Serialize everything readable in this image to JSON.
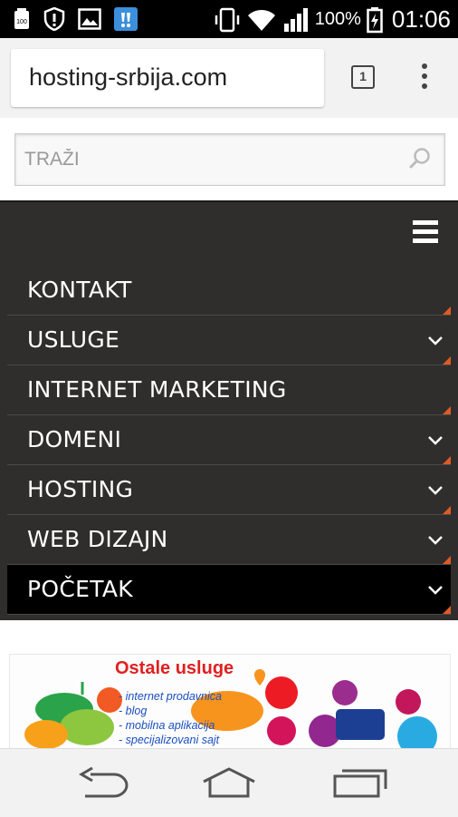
{
  "status_bar": {
    "battery_percent": "100%",
    "time": "01:06",
    "left_icons": [
      "storage-icon",
      "alert-shield-icon",
      "gallery-icon",
      "app-notification-icon"
    ],
    "right_icons": [
      "vibrate-icon",
      "wifi-icon",
      "signal-icon",
      "battery-icon"
    ]
  },
  "browser": {
    "url": "hosting-srbija.com",
    "tab_count": "1"
  },
  "search": {
    "placeholder": "TRAŽI"
  },
  "menu": {
    "items": [
      {
        "label": "KONTAKT",
        "has_submenu": false,
        "active": false
      },
      {
        "label": "USLUGE",
        "has_submenu": true,
        "active": false
      },
      {
        "label": "INTERNET MARKETING",
        "has_submenu": false,
        "active": false
      },
      {
        "label": "DOMENI",
        "has_submenu": true,
        "active": false
      },
      {
        "label": "HOSTING",
        "has_submenu": true,
        "active": false
      },
      {
        "label": "WEB DIZAJN",
        "has_submenu": true,
        "active": false
      },
      {
        "label": "POČETAK",
        "has_submenu": true,
        "active": true
      }
    ]
  },
  "banner": {
    "title": "Ostale usluge",
    "list": [
      "- internet prodavnica",
      "- blog",
      "- mobilna aplikacija",
      "- specijalizovani sajt"
    ]
  },
  "colors": {
    "nav_bg": "#2f2e2d",
    "active_bg": "#000000",
    "accent": "#e05a24"
  }
}
